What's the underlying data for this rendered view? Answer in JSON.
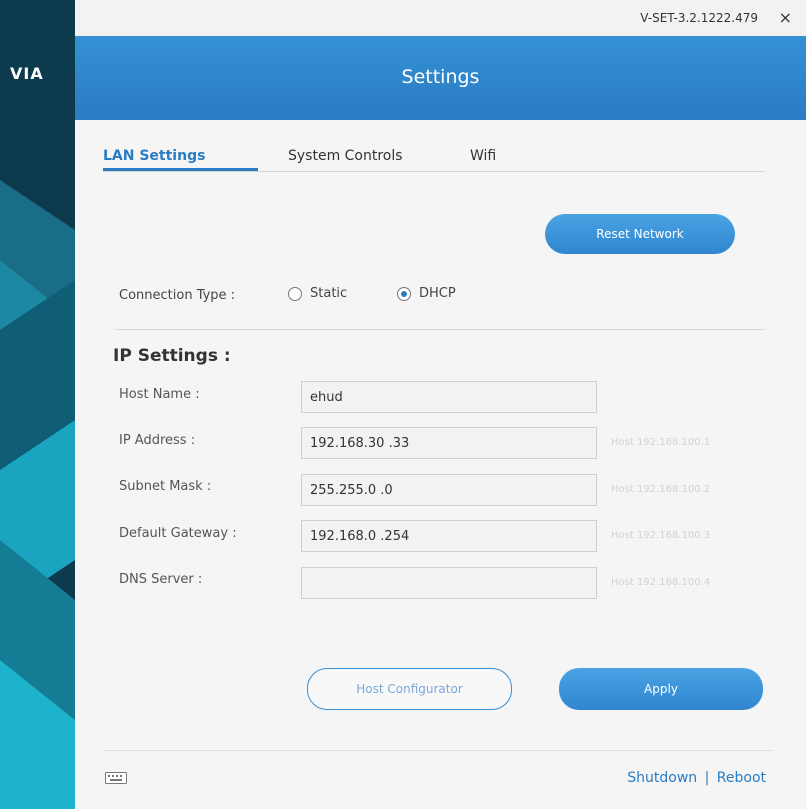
{
  "sidebar": {
    "logo": "VIA"
  },
  "window": {
    "version": "V-SET-3.2.1222.479",
    "close_glyph": "×"
  },
  "header": {
    "title": "Settings"
  },
  "tabs": [
    {
      "label": "LAN Settings",
      "active": true
    },
    {
      "label": "System Controls",
      "active": false
    },
    {
      "label": "Wifi",
      "active": false
    }
  ],
  "reset_button": {
    "label": "Reset Network"
  },
  "connection": {
    "label": "Connection Type :",
    "options": [
      {
        "label": "Static",
        "checked": false
      },
      {
        "label": "DHCP",
        "checked": true
      }
    ]
  },
  "ip_settings": {
    "title": "IP Settings :",
    "fields": [
      {
        "label": "Host Name :",
        "value": "ehud",
        "hint": ""
      },
      {
        "label": "IP Address :",
        "value": "192.168.30 .33",
        "hint": "Host 192.168.100.1"
      },
      {
        "label": "Subnet Mask :",
        "value": "255.255.0 .0",
        "hint": "Host 192.168.100.2"
      },
      {
        "label": "Default Gateway :",
        "value": "192.168.0 .254",
        "hint": "Host 192.168.100.3"
      },
      {
        "label": "DNS Server :",
        "value": "",
        "hint": "Host 192.168.100.4"
      }
    ]
  },
  "buttons": {
    "host_configurator": "Host Configurator",
    "apply": "Apply"
  },
  "footer": {
    "shutdown": "Shutdown",
    "separator": "|",
    "reboot": "Reboot"
  },
  "icons": {
    "keyboard": "keyboard-icon",
    "close": "close-icon"
  },
  "colors": {
    "accent": "#2a7cc2",
    "header": "#3590d5",
    "sidebar": "#0e3a4d"
  }
}
